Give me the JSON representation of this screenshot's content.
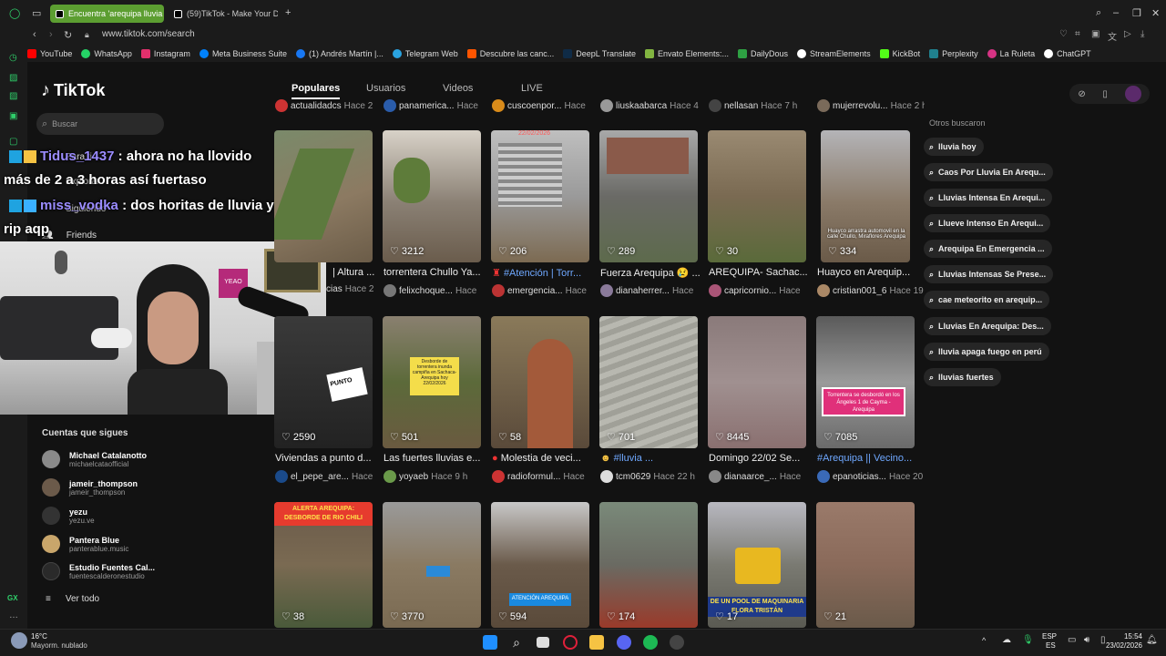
{
  "browser": {
    "tabs": [
      {
        "label": "Encuentra 'arequipa lluvia"
      },
      {
        "label": "(59)TikTok - Make Your Da"
      }
    ],
    "url": "www.tiktok.com/search",
    "bookmarks": [
      "YouTube",
      "WhatsApp",
      "Instagram",
      "Meta Business Suite",
      "(1) Andrés Martín |...",
      "Telegram Web",
      "Descubre las canc...",
      "DeepL Translate",
      "Envato Elements:...",
      "DailyDous",
      "StreamElements",
      "KickBot",
      "Perplexity",
      "La Ruleta",
      "ChatGPT"
    ],
    "bookmark_colors": [
      "#ff0000",
      "#25d366",
      "#e1306c",
      "#0081fb",
      "#1877f2",
      "#2aa3e0",
      "#ff5500",
      "#0f2b46",
      "#82b541",
      "#2ea043",
      "#ffffff",
      "#53fc18",
      "#20808d",
      "#d63384",
      "#ffffff"
    ]
  },
  "tiktok": {
    "logo": "TikTok",
    "search_placeholder": "Buscar",
    "nav": [
      "Para ti",
      "Explorar",
      "Siguiendo",
      "Friends"
    ],
    "following_header": "Cuentas que sigues",
    "following": [
      {
        "name": "Michael Catalanotto",
        "user": "michaelcataofficial"
      },
      {
        "name": "jameir_thompson",
        "user": "jameir_thompson"
      },
      {
        "name": "yezu",
        "user": "yezu.ve"
      },
      {
        "name": "Pantera Blue",
        "user": "panterablue.music"
      },
      {
        "name": "Estudio Fuentes Cal...",
        "user": "fuentescalderonestudio"
      }
    ],
    "see_all": "Ver todo",
    "tabs": [
      "Populares",
      "Usuarios",
      "Videos",
      "LIVE"
    ],
    "top_row_meta": [
      {
        "user": "actualidadcs",
        "ago": "Hace 2"
      },
      {
        "user": "panamerica...",
        "ago": "Hace"
      },
      {
        "user": "cuscoenpor...",
        "ago": "Hace"
      },
      {
        "user": "liuskaabarca",
        "ago": "Hace 4"
      },
      {
        "user": "nellasan",
        "ago": "Hace 7 h"
      },
      {
        "user": "mujerrevolu...",
        "ago": "Hace 2 h"
      }
    ],
    "row1": [
      {
        "likes": "",
        "title": "| Altura ...",
        "user": "cias",
        "ago": "Hace 2"
      },
      {
        "likes": "3212",
        "title": "torrentera Chullo Ya...",
        "user": "felixchoque...",
        "ago": "Hace"
      },
      {
        "likes": "206",
        "title": "#Atención | Torr...",
        "user": "emergencia...",
        "ago": "Hace"
      },
      {
        "likes": "289",
        "title": "Fuerza Arequipa 😢 ...",
        "user": "dianaherrer...",
        "ago": "Hace"
      },
      {
        "likes": "30",
        "title": "AREQUIPA- Sachac...",
        "user": "capricornio...",
        "ago": "Hace"
      },
      {
        "likes": "334",
        "title": "Huayco en Arequip...",
        "user": "cristian001_6",
        "ago": "Hace 19 h"
      }
    ],
    "row2": [
      {
        "likes": "2590",
        "title": "Viviendas a punto d...",
        "user": "el_pepe_are...",
        "ago": "Hace"
      },
      {
        "likes": "501",
        "title": "Las fuertes lluvias e...",
        "user": "yoyaeb",
        "ago": "Hace 9 h"
      },
      {
        "likes": "58",
        "title": "Molestia de veci...",
        "user": "radioformul...",
        "ago": "Hace"
      },
      {
        "likes": "701",
        "title": "#lluvia ...",
        "user": "tcm0629",
        "ago": "Hace 22 h"
      },
      {
        "likes": "8445",
        "title": "Domingo 22/02 Se...",
        "user": "dianaarce_...",
        "ago": "Hace"
      },
      {
        "likes": "7085",
        "title": "#Arequipa || Vecino...",
        "user": "epanoticias...",
        "ago": "Hace 20 h"
      }
    ],
    "row3": [
      {
        "likes": "38"
      },
      {
        "likes": "3770"
      },
      {
        "likes": "594"
      },
      {
        "likes": "174"
      },
      {
        "likes": "17"
      },
      {
        "likes": "21"
      }
    ],
    "overlay_texts": {
      "date": "22/02/2026",
      "huayco": "Huayco arrastra automovil en la calle Chullo, Miraflores Arequipa",
      "punto": "PUNTO",
      "desborde": "Desborde de torrentera inunda campiña en Sachaca- Arequipa hoy 22/02/2026",
      "torrentera": "Torrentera se desbordó en los Ángeles 1 de Cayma - Arequipa",
      "alerta": "ALERTA AREQUIPA: DESBORDE DE RIO CHILI",
      "atencion": "ATENCIÓN AREQUIPA",
      "pool": "DE UN POOL DE MAQUINARIA FLORA TRISTÁN"
    },
    "related_header": "Otros buscaron",
    "related": [
      "lluvia hoy",
      "Caos Por Lluvia En Arequ...",
      "Lluvias Intensa En Arequi...",
      "Llueve Intenso En Arequi...",
      "Arequipa En Emergencia ...",
      "Lluvias Intensas Se Prese...",
      "cae meteorito en arequip...",
      "Lluvias En Arequipa: Des...",
      "lluvia apaga fuego en perú",
      "lluvias fuertes"
    ]
  },
  "chat": [
    {
      "user": "Tidus_1437",
      "message": ": ahora no ha llovido",
      "cont": "más de 2 a 3 horas así fuertaso"
    },
    {
      "user": "miss_vodka",
      "message": ": dos horitas de lluvia y",
      "cont": "rip aqp"
    }
  ],
  "taskbar": {
    "temp": "16°C",
    "weather": "Mayorm. nublado",
    "lang": "ESP",
    "lang2": "ES",
    "time": "15:54",
    "date": "23/02/2026"
  },
  "stream_overlay": {
    "sign": "YEAO"
  }
}
